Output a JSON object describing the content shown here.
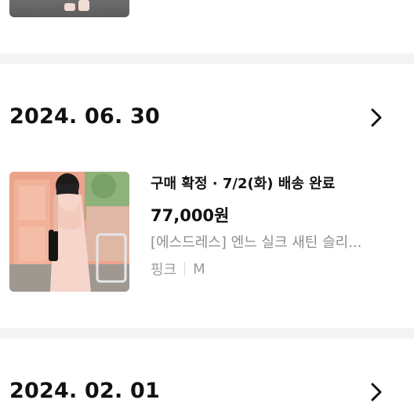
{
  "orders": [
    {
      "date": "2024. 06. 30",
      "status": "구매 확정 · 7/2(화) 배송 완료",
      "price": "77,000원",
      "product_name": "[에스드레스] 엔느 실크 새틴 슬리...",
      "option_color": "핑크",
      "option_size": "M"
    },
    {
      "date": "2024. 02. 01"
    }
  ],
  "colors": {
    "separator": "#f4f4f4",
    "text_primary": "#111111",
    "text_secondary": "#8e8e8e"
  },
  "icons": {
    "detail": "chevron-right-icon"
  }
}
